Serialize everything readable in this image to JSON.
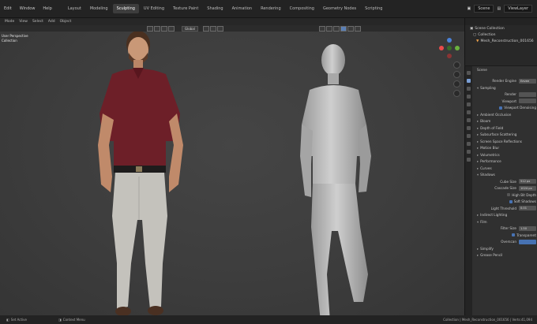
{
  "topbar": {
    "menus": [
      "Edit",
      "Window",
      "Help"
    ],
    "tabs": [
      "Layout",
      "Modeling",
      "Sculpting",
      "UV Editing",
      "Texture Paint",
      "Shading",
      "Animation",
      "Rendering",
      "Compositing",
      "Geometry Nodes",
      "Scripting"
    ],
    "active_tab": "Sculpting",
    "scene": "Scene",
    "view_layer": "ViewLayer"
  },
  "header": {
    "mode": "Mode",
    "items": [
      "View",
      "Select",
      "Add",
      "Object"
    ]
  },
  "viewport_toolbar": {
    "orientation": "Global"
  },
  "viewport": {
    "overlay_line1": "User Perspective",
    "overlay_line2": "Collection"
  },
  "gizmo_colors": {
    "x": "#e94b4b",
    "y": "#6bb23e",
    "z": "#4a82d9",
    "nx": "#8a3434",
    "ny": "#3a6b28"
  },
  "outliner": {
    "title": "Scene Collection",
    "collection": "Collection",
    "object": "Mesh_Reconstruction_001656"
  },
  "properties": {
    "scene_label": "Scene",
    "render_engine_label": "Render Engine",
    "render_engine_value": "Eevee",
    "sampling": "Sampling",
    "render_label": "Render",
    "viewport_label": "Viewport",
    "viewport_denoise": "Viewport Denoising",
    "panels": [
      "Ambient Occlusion",
      "Bloom",
      "Depth of Field",
      "Subsurface Scattering",
      "Screen Space Reflections",
      "Motion Blur",
      "Volumetrics",
      "Performance",
      "Curves"
    ],
    "shadows": "Shadows",
    "cube_size_label": "Cube Size",
    "cube_size_value": "512 px",
    "cascade_size_label": "Cascade Size",
    "cascade_size_value": "1024 px",
    "high_bit_depth": "High Bit Depth",
    "soft_shadows": "Soft Shadows",
    "light_threshold_label": "Light Threshold",
    "light_threshold_value": "0.01",
    "indirect_lighting": "Indirect Lighting",
    "film": "Film",
    "filter_size_label": "Filter Size",
    "filter_size_value": "1.50",
    "transparent": "Transparent",
    "overscan": "Overscan",
    "simplify": "Simplify",
    "grease_pencil": "Grease Pencil"
  },
  "statusbar": {
    "left": "Set Active",
    "middle": "Context Menu",
    "right": "Collection | Mesh_Reconstruction_001656 | Verts:41,094"
  }
}
